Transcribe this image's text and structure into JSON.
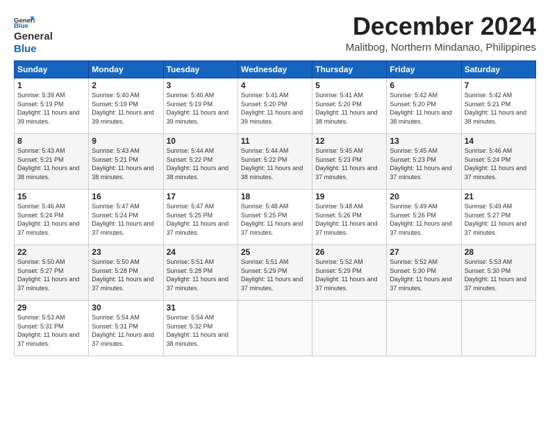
{
  "header": {
    "logo_line1": "General",
    "logo_line2": "Blue",
    "month": "December 2024",
    "location": "Malitbog, Northern Mindanao, Philippines"
  },
  "days_of_week": [
    "Sunday",
    "Monday",
    "Tuesday",
    "Wednesday",
    "Thursday",
    "Friday",
    "Saturday"
  ],
  "weeks": [
    [
      {
        "day": "1",
        "rise": "5:39 AM",
        "set": "5:19 PM",
        "daylight": "11 hours and 39 minutes."
      },
      {
        "day": "2",
        "rise": "5:40 AM",
        "set": "5:19 PM",
        "daylight": "11 hours and 39 minutes."
      },
      {
        "day": "3",
        "rise": "5:40 AM",
        "set": "5:19 PM",
        "daylight": "11 hours and 39 minutes."
      },
      {
        "day": "4",
        "rise": "5:41 AM",
        "set": "5:20 PM",
        "daylight": "11 hours and 39 minutes."
      },
      {
        "day": "5",
        "rise": "5:41 AM",
        "set": "5:20 PM",
        "daylight": "11 hours and 38 minutes."
      },
      {
        "day": "6",
        "rise": "5:42 AM",
        "set": "5:20 PM",
        "daylight": "11 hours and 38 minutes."
      },
      {
        "day": "7",
        "rise": "5:42 AM",
        "set": "5:21 PM",
        "daylight": "11 hours and 38 minutes."
      }
    ],
    [
      {
        "day": "8",
        "rise": "5:43 AM",
        "set": "5:21 PM",
        "daylight": "11 hours and 38 minutes."
      },
      {
        "day": "9",
        "rise": "5:43 AM",
        "set": "5:21 PM",
        "daylight": "11 hours and 38 minutes."
      },
      {
        "day": "10",
        "rise": "5:44 AM",
        "set": "5:22 PM",
        "daylight": "11 hours and 38 minutes."
      },
      {
        "day": "11",
        "rise": "5:44 AM",
        "set": "5:22 PM",
        "daylight": "11 hours and 38 minutes."
      },
      {
        "day": "12",
        "rise": "5:45 AM",
        "set": "5:23 PM",
        "daylight": "11 hours and 37 minutes."
      },
      {
        "day": "13",
        "rise": "5:45 AM",
        "set": "5:23 PM",
        "daylight": "11 hours and 37 minutes."
      },
      {
        "day": "14",
        "rise": "5:46 AM",
        "set": "5:24 PM",
        "daylight": "11 hours and 37 minutes."
      }
    ],
    [
      {
        "day": "15",
        "rise": "5:46 AM",
        "set": "5:24 PM",
        "daylight": "11 hours and 37 minutes."
      },
      {
        "day": "16",
        "rise": "5:47 AM",
        "set": "5:24 PM",
        "daylight": "11 hours and 37 minutes."
      },
      {
        "day": "17",
        "rise": "5:47 AM",
        "set": "5:25 PM",
        "daylight": "11 hours and 37 minutes."
      },
      {
        "day": "18",
        "rise": "5:48 AM",
        "set": "5:25 PM",
        "daylight": "11 hours and 37 minutes."
      },
      {
        "day": "19",
        "rise": "5:48 AM",
        "set": "5:26 PM",
        "daylight": "11 hours and 37 minutes."
      },
      {
        "day": "20",
        "rise": "5:49 AM",
        "set": "5:26 PM",
        "daylight": "11 hours and 37 minutes."
      },
      {
        "day": "21",
        "rise": "5:49 AM",
        "set": "5:27 PM",
        "daylight": "11 hours and 37 minutes."
      }
    ],
    [
      {
        "day": "22",
        "rise": "5:50 AM",
        "set": "5:27 PM",
        "daylight": "11 hours and 37 minutes."
      },
      {
        "day": "23",
        "rise": "5:50 AM",
        "set": "5:28 PM",
        "daylight": "11 hours and 37 minutes."
      },
      {
        "day": "24",
        "rise": "5:51 AM",
        "set": "5:28 PM",
        "daylight": "11 hours and 37 minutes."
      },
      {
        "day": "25",
        "rise": "5:51 AM",
        "set": "5:29 PM",
        "daylight": "11 hours and 37 minutes."
      },
      {
        "day": "26",
        "rise": "5:52 AM",
        "set": "5:29 PM",
        "daylight": "11 hours and 37 minutes."
      },
      {
        "day": "27",
        "rise": "5:52 AM",
        "set": "5:30 PM",
        "daylight": "11 hours and 37 minutes."
      },
      {
        "day": "28",
        "rise": "5:53 AM",
        "set": "5:30 PM",
        "daylight": "11 hours and 37 minutes."
      }
    ],
    [
      {
        "day": "29",
        "rise": "5:53 AM",
        "set": "5:31 PM",
        "daylight": "11 hours and 37 minutes."
      },
      {
        "day": "30",
        "rise": "5:54 AM",
        "set": "5:31 PM",
        "daylight": "11 hours and 37 minutes."
      },
      {
        "day": "31",
        "rise": "5:54 AM",
        "set": "5:32 PM",
        "daylight": "11 hours and 38 minutes."
      },
      null,
      null,
      null,
      null
    ]
  ],
  "labels": {
    "sunrise": "Sunrise:",
    "sunset": "Sunset:",
    "daylight": "Daylight:"
  }
}
